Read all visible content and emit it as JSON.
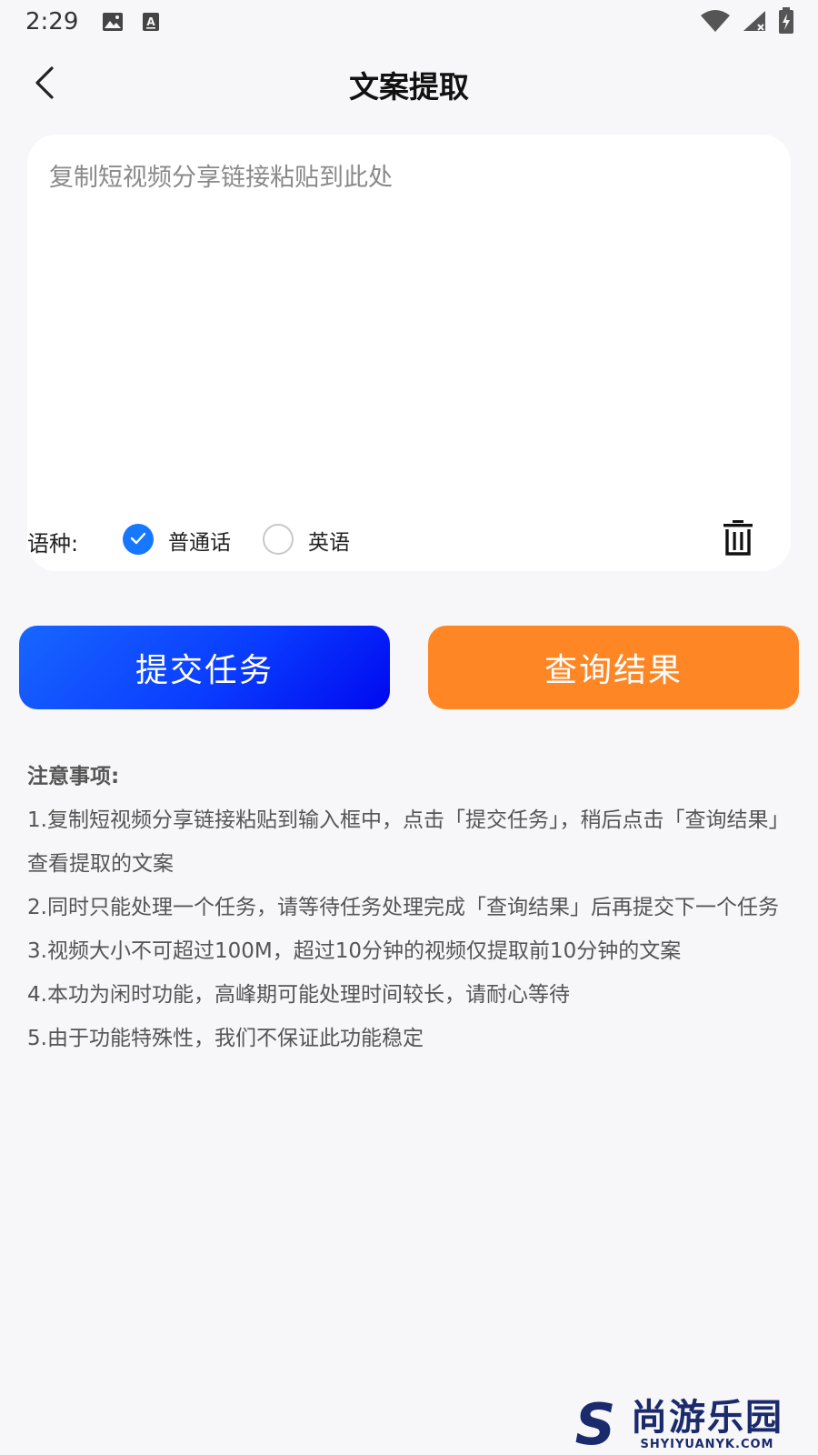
{
  "status_bar": {
    "time": "2:29",
    "icons": [
      "image-icon",
      "a-text-icon"
    ],
    "right_icons": [
      "wifi-icon",
      "signal-icon",
      "battery-icon"
    ]
  },
  "header": {
    "title": "文案提取",
    "back_icon": "chevron-left-icon"
  },
  "input": {
    "value": "",
    "placeholder": "复制短视频分享链接粘贴到此处"
  },
  "language": {
    "label": "语种:",
    "options": [
      {
        "label": "普通话",
        "selected": true
      },
      {
        "label": "英语",
        "selected": false
      }
    ],
    "clear_icon": "trash-icon"
  },
  "actions": {
    "submit_label": "提交任务",
    "query_label": "查询结果"
  },
  "notes": {
    "title": "注意事项:",
    "items": [
      "1.复制短视频分享链接粘贴到输入框中，点击「提交任务」，稍后点击「查询结果」查看提取的文案",
      "2.同时只能处理一个任务，请等待任务处理完成「查询结果」后再提交下一个任务",
      "3.视频大小不可超过100M，超过10分钟的视频仅提取前10分钟的文案",
      "4.本功为闲时功能，高峰期可能处理时间较长，请耐心等待",
      "5.由于功能特殊性，我们不保证此功能稳定"
    ]
  },
  "watermark": {
    "logo_letter": "S",
    "name": "尚游乐园",
    "domain": "SHYIYUANYK.COM"
  },
  "colors": {
    "accent_blue": "#1677ff",
    "submit_gradient_end": "#0008f0",
    "query_orange": "#ff8625",
    "background": "#f7f7f9"
  }
}
